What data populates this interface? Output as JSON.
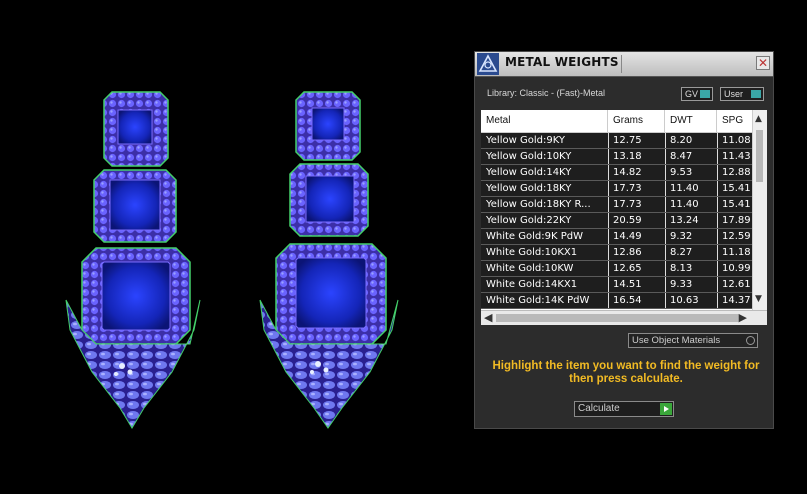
{
  "panel": {
    "title": "METAL WEIGHTS",
    "close_glyph": "✕",
    "library_label": "Library: Classic - (Fast)-Metal",
    "toggles": [
      {
        "label": "GV",
        "state": "on"
      },
      {
        "label": "User",
        "state": "on"
      }
    ]
  },
  "table": {
    "columns": [
      "Metal",
      "Grams",
      "DWT",
      "SPG"
    ],
    "rows": [
      {
        "metal": "Yellow Gold:9KY",
        "grams": "12.75",
        "dwt": "8.20",
        "spg": "11.08"
      },
      {
        "metal": "Yellow Gold:10KY",
        "grams": "13.18",
        "dwt": "8.47",
        "spg": "11.43"
      },
      {
        "metal": "Yellow Gold:14KY",
        "grams": "14.82",
        "dwt": "9.53",
        "spg": "12.88"
      },
      {
        "metal": "Yellow Gold:18KY",
        "grams": "17.73",
        "dwt": "11.40",
        "spg": "15.41"
      },
      {
        "metal": "Yellow Gold:18KY R...",
        "grams": "17.73",
        "dwt": "11.40",
        "spg": "15.41"
      },
      {
        "metal": "Yellow Gold:22KY",
        "grams": "20.59",
        "dwt": "13.24",
        "spg": "17.89"
      },
      {
        "metal": "White Gold:9K PdW",
        "grams": "14.49",
        "dwt": "9.32",
        "spg": "12.59"
      },
      {
        "metal": "White Gold:10KX1",
        "grams": "12.86",
        "dwt": "8.27",
        "spg": "11.18"
      },
      {
        "metal": "White Gold:10KW",
        "grams": "12.65",
        "dwt": "8.13",
        "spg": "10.99"
      },
      {
        "metal": "White Gold:14KX1",
        "grams": "14.51",
        "dwt": "9.33",
        "spg": "12.61"
      },
      {
        "metal": "White Gold:14K PdW",
        "grams": "16.54",
        "dwt": "10.63",
        "spg": "14.37"
      }
    ]
  },
  "scrollbars": {
    "up_glyph": "▲",
    "down_glyph": "▼",
    "left_glyph": "◀",
    "right_glyph": "▶"
  },
  "use_object_materials": "Use Object Materials",
  "instructions": "Highlight the item you want to find the weight for then press calculate.",
  "calculate_label": "Calculate",
  "colors": {
    "instruction_text": "#f2bb24",
    "toggle_accent": "#3aa7a7",
    "calculate_accent": "#3aa63a",
    "gem_blue": "#1a2fd6",
    "metal_purple": "#6b5cff",
    "metal_green": "#3fcf6a"
  },
  "icons": {
    "app_logo": "triangle-compass-logo",
    "close": "close-icon"
  }
}
